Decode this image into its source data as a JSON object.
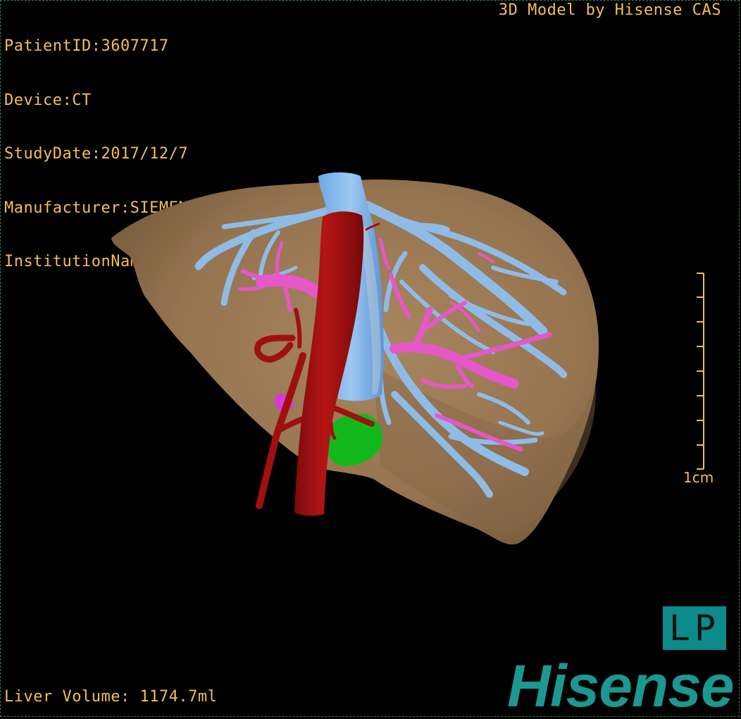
{
  "patient_info": {
    "patient_id": "PatientID:3607717",
    "device": "Device:CT",
    "study_date": "StudyDate:2017/12/7",
    "manufacturer": "Manufacturer:SIEMENS",
    "institution": "InstitutionName:Affiliated Hospital Qingdao University-C"
  },
  "credit": "3D Model by Hisense CAS",
  "liver_volume": "Liver Volume: 1174.7ml",
  "scale_label": "1cm",
  "orientation_label": "LP",
  "brand": "Hisense",
  "colors": {
    "text": "#f0c050",
    "liver": "#9b7a55",
    "hepatic_vein": "#8fbce6",
    "portal_vein": "#e657c8",
    "artery": "#a01010",
    "gallbladder": "#12b81b",
    "brand": "#1b9890"
  }
}
